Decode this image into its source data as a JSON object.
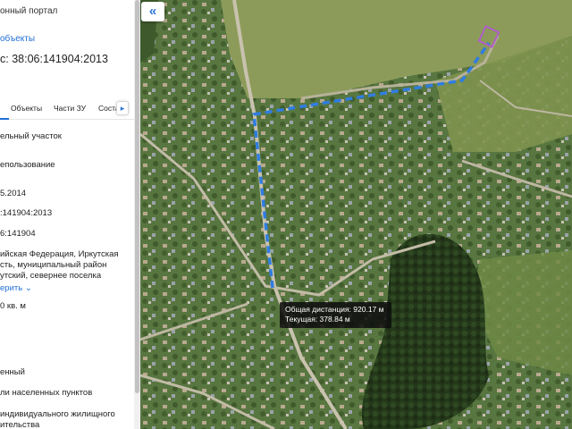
{
  "sidebar": {
    "portal_title": "онный портал",
    "back_link": "объекты",
    "cadastral_number": "с: 38:06:141904:2013",
    "tabs": [
      "Объекты",
      "Части ЗУ",
      "Соста"
    ],
    "tabs_next_icon": "chevron-right",
    "fields": [
      "ельный участок",
      "епользование",
      "5.2014",
      ":141904:2013",
      "6:141904"
    ],
    "address_lines": "ийская Федерация, Иркутская\nсть, муниципальный район\nутский, севернее поселка",
    "expand_link": "ерить ⌄",
    "area": "0 кв. м",
    "bottom_fields": [
      "енный",
      "ли населенных пунктов",
      "индивидуального жилищного",
      "ительства"
    ]
  },
  "map": {
    "collapse_icon": "double-chevron-left",
    "route_color": "#2f7de0",
    "parcel_color": "#b05dc8",
    "tooltip": {
      "total_distance": "Общая дистанция: 920.17 м",
      "current": "Текущая: 378.84 м"
    }
  }
}
